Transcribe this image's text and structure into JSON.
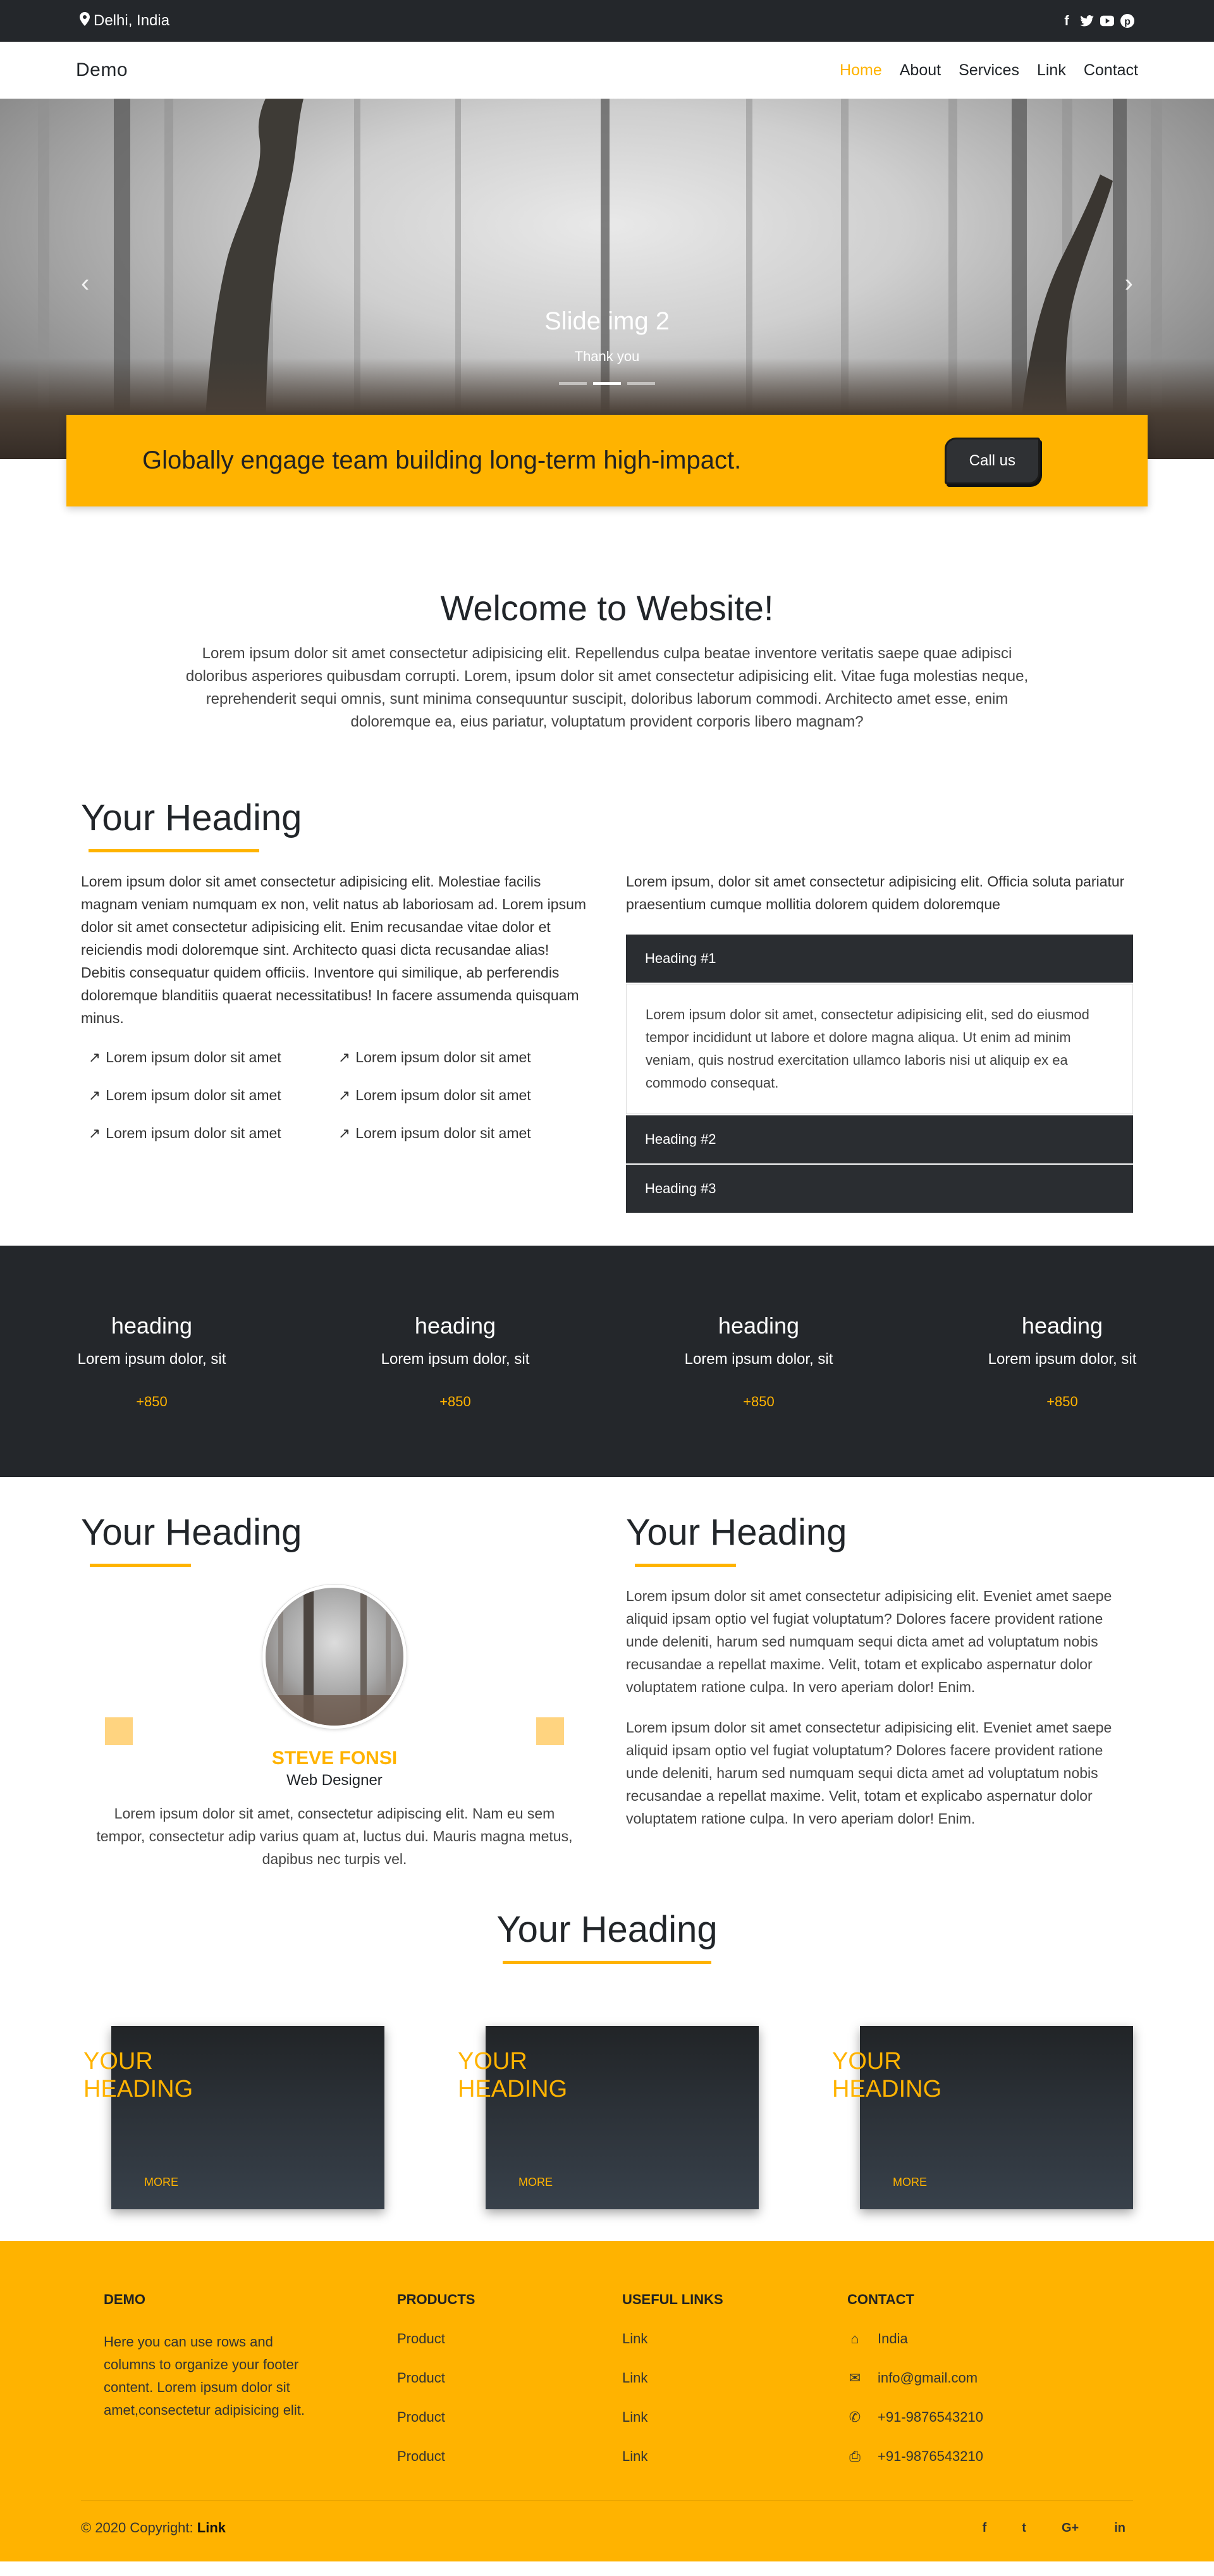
{
  "topbar": {
    "location": "Delhi, India",
    "social": [
      "facebook-icon",
      "twitter-icon",
      "youtube-icon",
      "pinterest-icon"
    ]
  },
  "nav": {
    "brand": "Demo",
    "items": [
      "Home",
      "About",
      "Services",
      "Link",
      "Contact"
    ],
    "active": "Home"
  },
  "hero": {
    "title": "Slide img 2",
    "subtitle": "Thank you",
    "indicators": 3,
    "active_indicator": 2
  },
  "cta": {
    "text": "Globally engage team building long-term high-impact.",
    "button": "Call us"
  },
  "welcome": {
    "title": "Welcome to Website!",
    "text": "Lorem ipsum dolor sit amet consectetur adipisicing elit. Repellendus culpa beatae inventore veritatis saepe quae adipisci doloribus asperiores quibusdam corrupti. Lorem, ipsum dolor sit amet consectetur adipisicing elit. Vitae fuga molestias neque, reprehenderit sequi omnis, sunt minima consequuntur suscipit, doloribus laborum commodi. Architecto amet esse, enim doloremque ea, eius pariatur, voluptatum provident corporis libero magnam?"
  },
  "features": {
    "heading": "Your Heading",
    "left_text": "Lorem ipsum dolor sit amet consectetur adipisicing elit. Molestiae facilis magnam veniam numquam ex non, velit natus ab laboriosam ad. Lorem ipsum dolor sit amet consectetur adipisicing elit. Enim recusandae vitae dolor et reiciendis modi doloremque sint. Architecto quasi dicta recusandae alias! Debitis consequatur quidem officiis. Inventore qui similique, ab perferendis doloremque blanditiis quaerat necessitatibus! In facere assumenda quisquam minus.",
    "bullets": [
      "Lorem ipsum dolor sit amet",
      "Lorem ipsum dolor sit amet",
      "Lorem ipsum dolor sit amet",
      "Lorem ipsum dolor sit amet",
      "Lorem ipsum dolor sit amet",
      "Lorem ipsum dolor sit amet"
    ],
    "right_text": "Lorem ipsum, dolor sit amet consectetur adipisicing elit. Officia soluta pariatur praesentium cumque mollitia dolorem quidem doloremque",
    "accordion": [
      {
        "title": "Heading #1",
        "body": "Lorem ipsum dolor sit amet, consectetur adipisicing elit, sed do eiusmod tempor incididunt ut labore et dolore magna aliqua. Ut enim ad minim veniam, quis nostrud exercitation ullamco laboris nisi ut aliquip ex ea commodo consequat."
      },
      {
        "title": "Heading #2"
      },
      {
        "title": "Heading #3"
      }
    ]
  },
  "stats": [
    {
      "heading": "heading",
      "text": "Lorem ipsum dolor, sit",
      "value": "+850"
    },
    {
      "heading": "heading",
      "text": "Lorem ipsum dolor, sit",
      "value": "+850"
    },
    {
      "heading": "heading",
      "text": "Lorem ipsum dolor, sit",
      "value": "+850"
    },
    {
      "heading": "heading",
      "text": "Lorem ipsum dolor, sit",
      "value": "+850"
    }
  ],
  "about": {
    "left_heading": "Your Heading",
    "name": "STEVE FONSI",
    "role": "Web Designer",
    "testimonial": "Lorem ipsum dolor sit amet, consectetur adipiscing elit. Nam eu sem tempor, consectetur adip varius quam at, luctus dui. Mauris magna metus, dapibus nec turpis vel.",
    "right_heading": "Your Heading",
    "para1": "Lorem ipsum dolor sit amet consectetur adipisicing elit. Eveniet amet saepe aliquid ipsam optio vel fugiat voluptatum? Dolores facere provident ratione unde deleniti, harum sed numquam sequi dicta amet ad voluptatum nobis recusandae a repellat maxime. Velit, totam et explicabo aspernatur dolor voluptatem ratione culpa. In vero aperiam dolor! Enim.",
    "para2": "Lorem ipsum dolor sit amet consectetur adipisicing elit. Eveniet amet saepe aliquid ipsam optio vel fugiat voluptatum? Dolores facere provident ratione unde deleniti, harum sed numquam sequi dicta amet ad voluptatum nobis recusandae a repellat maxime. Velit, totam et explicabo aspernatur dolor voluptatem ratione culpa. In vero aperiam dolor! Enim."
  },
  "cards": {
    "heading": "Your Heading",
    "items": [
      {
        "line1": "YOUR",
        "line2": "HEADING",
        "more": "MORE"
      },
      {
        "line1": "YOUR",
        "line2": "HEADING",
        "more": "MORE"
      },
      {
        "line1": "YOUR",
        "line2": "HEADING",
        "more": "MORE"
      }
    ]
  },
  "footer": {
    "demo_title": "DEMO",
    "demo_text": "Here you can use rows and columns to organize your footer content. Lorem ipsum dolor sit amet,consectetur adipisicing elit.",
    "products_title": "PRODUCTS",
    "products": [
      "Product",
      "Product",
      "Product",
      "Product"
    ],
    "links_title": "USEFUL LINKS",
    "links": [
      "Link",
      "Link",
      "Link",
      "Link"
    ],
    "contact_title": "CONTACT",
    "contact": [
      {
        "icon": "home-icon",
        "text": "India"
      },
      {
        "icon": "envelope-icon",
        "text": "info@gmail.com"
      },
      {
        "icon": "phone-icon",
        "text": "+91-9876543210"
      },
      {
        "icon": "print-icon",
        "text": "+91-9876543210"
      }
    ],
    "copyright": "© 2020 Copyright:",
    "copyright_link": "Link",
    "social": [
      "f",
      "t",
      "G+",
      "in"
    ]
  },
  "colors": {
    "accent": "#ffb300",
    "dark": "#24272b"
  }
}
